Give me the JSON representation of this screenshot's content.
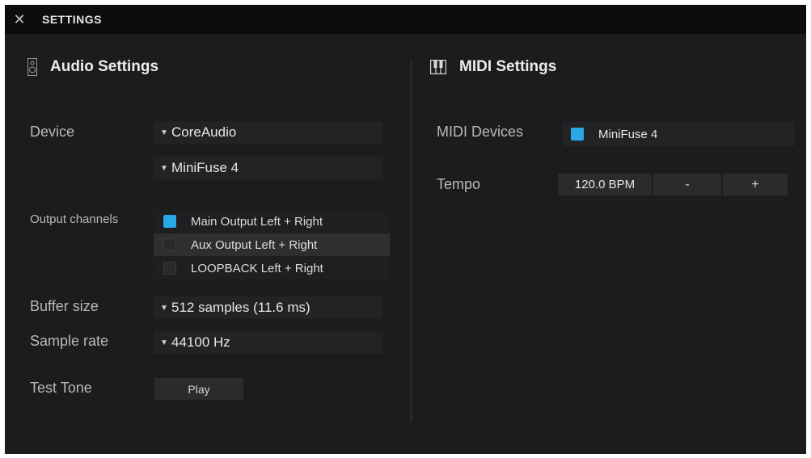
{
  "window": {
    "title": "SETTINGS",
    "close_glyph": "✕"
  },
  "audio": {
    "heading": "Audio Settings",
    "icon": "speaker-icon",
    "device_label": "Device",
    "device_driver": "CoreAudio",
    "device_name": "MiniFuse 4",
    "output_channels_label": "Output channels",
    "channels": [
      {
        "name": "Main Output Left + Right",
        "checked": true
      },
      {
        "name": "Aux Output Left + Right",
        "checked": false
      },
      {
        "name": "LOOPBACK Left + Right",
        "checked": false
      }
    ],
    "buffer_label": "Buffer size",
    "buffer_value": "512 samples (11.6 ms)",
    "sample_rate_label": "Sample rate",
    "sample_rate_value": "44100 Hz",
    "test_tone_label": "Test Tone",
    "play_label": "Play"
  },
  "midi": {
    "heading": "MIDI Settings",
    "icon": "piano-keys-icon",
    "devices_label": "MIDI Devices",
    "device_name": "MiniFuse 4",
    "device_checked": true,
    "tempo_label": "Tempo",
    "tempo_value": "120.0 BPM",
    "minus_label": "-",
    "plus_label": "+"
  },
  "colors": {
    "accent": "#2aa8e6",
    "background": "#1c1c1e",
    "titlebar": "#0d0d0e"
  }
}
